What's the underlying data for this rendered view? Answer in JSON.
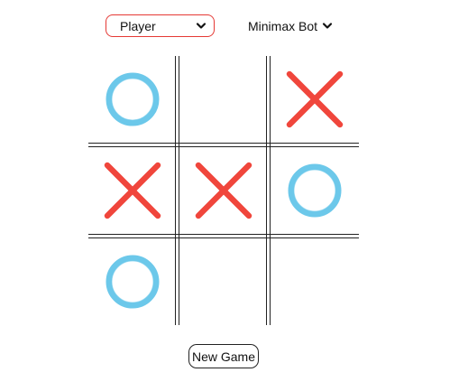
{
  "controls": {
    "player_select": {
      "value": "Player"
    },
    "opponent_select": {
      "value": "Minimax Bot"
    }
  },
  "board": {
    "cells": [
      "O",
      "",
      "X",
      "X",
      "X",
      "O",
      "O",
      "",
      ""
    ]
  },
  "colors": {
    "x_mark": "#f0463c",
    "o_mark": "#6cc8ea",
    "select_border": "#e53935"
  },
  "actions": {
    "new_game_label": "New Game"
  }
}
